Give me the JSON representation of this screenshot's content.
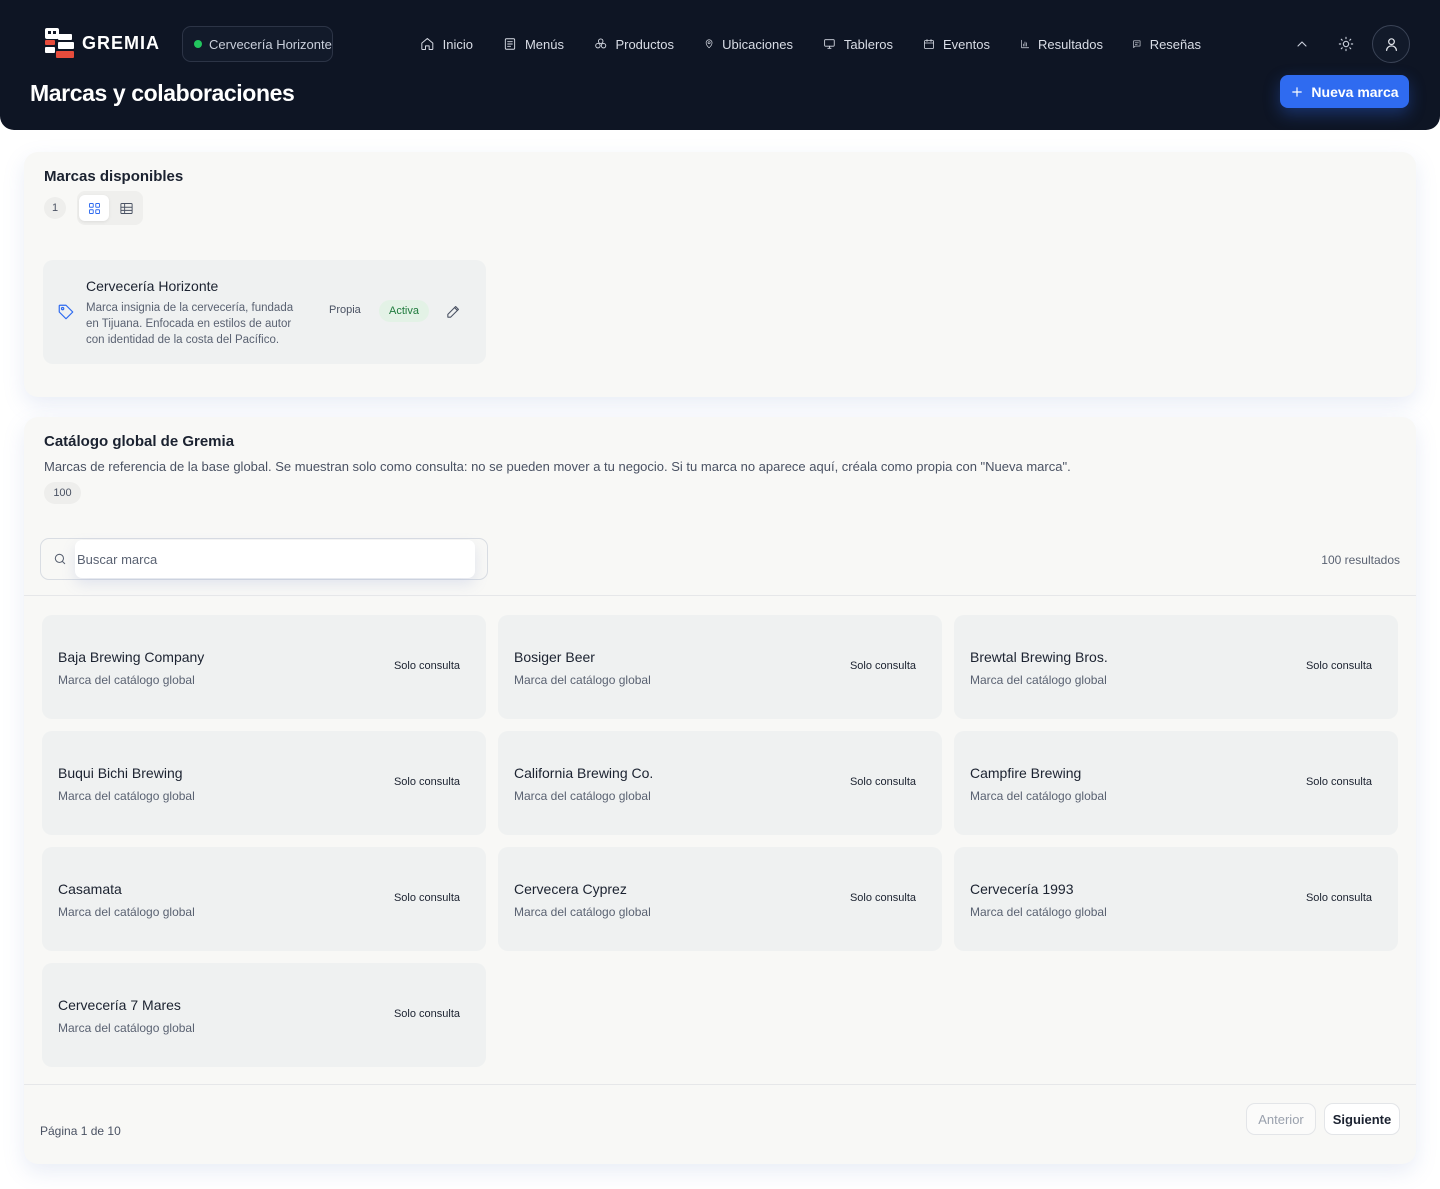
{
  "header": {
    "logo_text": "GREMIA",
    "business_name": "Cervecería Horizonte",
    "nav": [
      {
        "label": "Inicio",
        "icon": "home-icon"
      },
      {
        "label": "Menús",
        "icon": "menu-list-icon"
      },
      {
        "label": "Productos",
        "icon": "products-icon"
      },
      {
        "label": "Ubicaciones",
        "icon": "location-pin-icon"
      },
      {
        "label": "Tableros",
        "icon": "monitor-icon"
      },
      {
        "label": "Eventos",
        "icon": "calendar-icon"
      },
      {
        "label": "Resultados",
        "icon": "bar-chart-icon"
      },
      {
        "label": "Reseñas",
        "icon": "review-icon"
      }
    ],
    "page_title": "Marcas y colaboraciones",
    "new_brand_label": "Nueva marca"
  },
  "available": {
    "title": "Marcas disponibles",
    "count": "1",
    "brand": {
      "name": "Cervecería Horizonte",
      "description": "Marca insignia de la cervecería, fundada en Tijuana. Enfocada en estilos de autor con identidad de la costa del Pacífico.",
      "kind": "Propia",
      "status": "Activa"
    }
  },
  "catalog": {
    "title": "Catálogo global de Gremia",
    "description": "Marcas de referencia de la base global. Se muestran solo como consulta: no se pueden mover a tu negocio. Si tu marca no aparece aquí, créala como propia con \"Nueva marca\".",
    "count": "100",
    "search_placeholder": "Buscar marca",
    "result_count": "100 resultados",
    "brands": [
      {
        "name": "Baja Brewing Company",
        "sub": "Marca del catálogo global",
        "badge": "Solo consulta"
      },
      {
        "name": "Bosiger Beer",
        "sub": "Marca del catálogo global",
        "badge": "Solo consulta"
      },
      {
        "name": "Brewtal Brewing Bros.",
        "sub": "Marca del catálogo global",
        "badge": "Solo consulta"
      },
      {
        "name": "Buqui Bichi Brewing",
        "sub": "Marca del catálogo global",
        "badge": "Solo consulta"
      },
      {
        "name": "California Brewing Co.",
        "sub": "Marca del catálogo global",
        "badge": "Solo consulta"
      },
      {
        "name": "Campfire Brewing",
        "sub": "Marca del catálogo global",
        "badge": "Solo consulta"
      },
      {
        "name": "Casamata",
        "sub": "Marca del catálogo global",
        "badge": "Solo consulta"
      },
      {
        "name": "Cervecera Cyprez",
        "sub": "Marca del catálogo global",
        "badge": "Solo consulta"
      },
      {
        "name": "Cervecería 1993",
        "sub": "Marca del catálogo global",
        "badge": "Solo consulta"
      },
      {
        "name": "Cervecería 7 Mares",
        "sub": "Marca del catálogo global",
        "badge": "Solo consulta"
      }
    ],
    "pagination": {
      "label": "Página 1 de 10",
      "prev_label": "Anterior",
      "next_label": "Siguiente"
    }
  },
  "colors": {
    "header_bg": "#0e1524",
    "accent": "#2f6bf0",
    "active_green": "#22c55e"
  }
}
